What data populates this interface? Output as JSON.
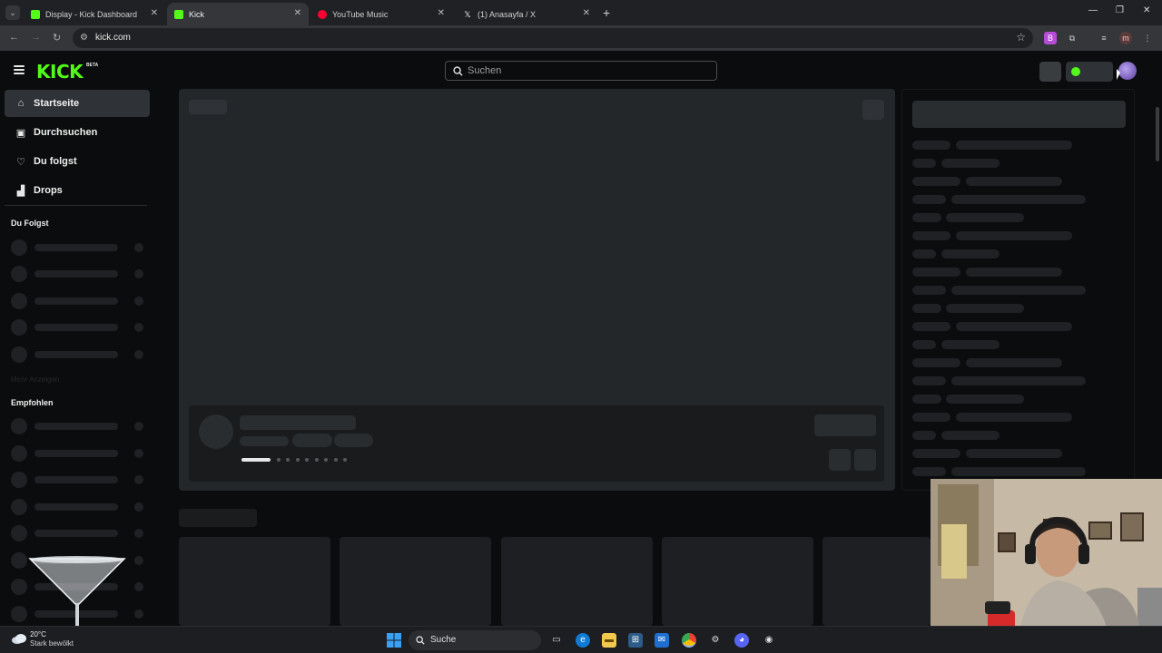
{
  "browser": {
    "tabs": [
      {
        "title": "Display - Kick Dashboard",
        "favicon_color": "#53fc18",
        "active": false
      },
      {
        "title": "Kick",
        "favicon_color": "#53fc18",
        "active": true
      },
      {
        "title": "YouTube Music",
        "favicon_color": "#ff0033",
        "active": false
      },
      {
        "title": "(1) Anasayfa / X",
        "favicon_color": "#ffffff",
        "active": false
      }
    ],
    "url": "kick.com",
    "profile_initial": "m"
  },
  "header": {
    "logo": "KICK",
    "logo_badge": "BETA",
    "search_placeholder": "Suchen"
  },
  "sidebar": {
    "nav": [
      {
        "label": "Startseite",
        "icon": "home-icon",
        "active": true
      },
      {
        "label": "Durchsuchen",
        "icon": "browse-icon",
        "active": false
      },
      {
        "label": "Du folgst",
        "icon": "heart-icon",
        "active": false
      },
      {
        "label": "Drops",
        "icon": "drops-icon",
        "active": false
      }
    ],
    "following_heading": "Du Folgst",
    "more_hint": "Mehr Anzeigen",
    "recommended_heading": "Empfohlen"
  },
  "taskbar": {
    "search_label": "Suche",
    "weather_temp": "20°C",
    "weather_desc": "Stark bewölkt"
  },
  "colors": {
    "brand": "#53fc18",
    "background": "#0b0c0d",
    "skeleton": "#24272a"
  }
}
